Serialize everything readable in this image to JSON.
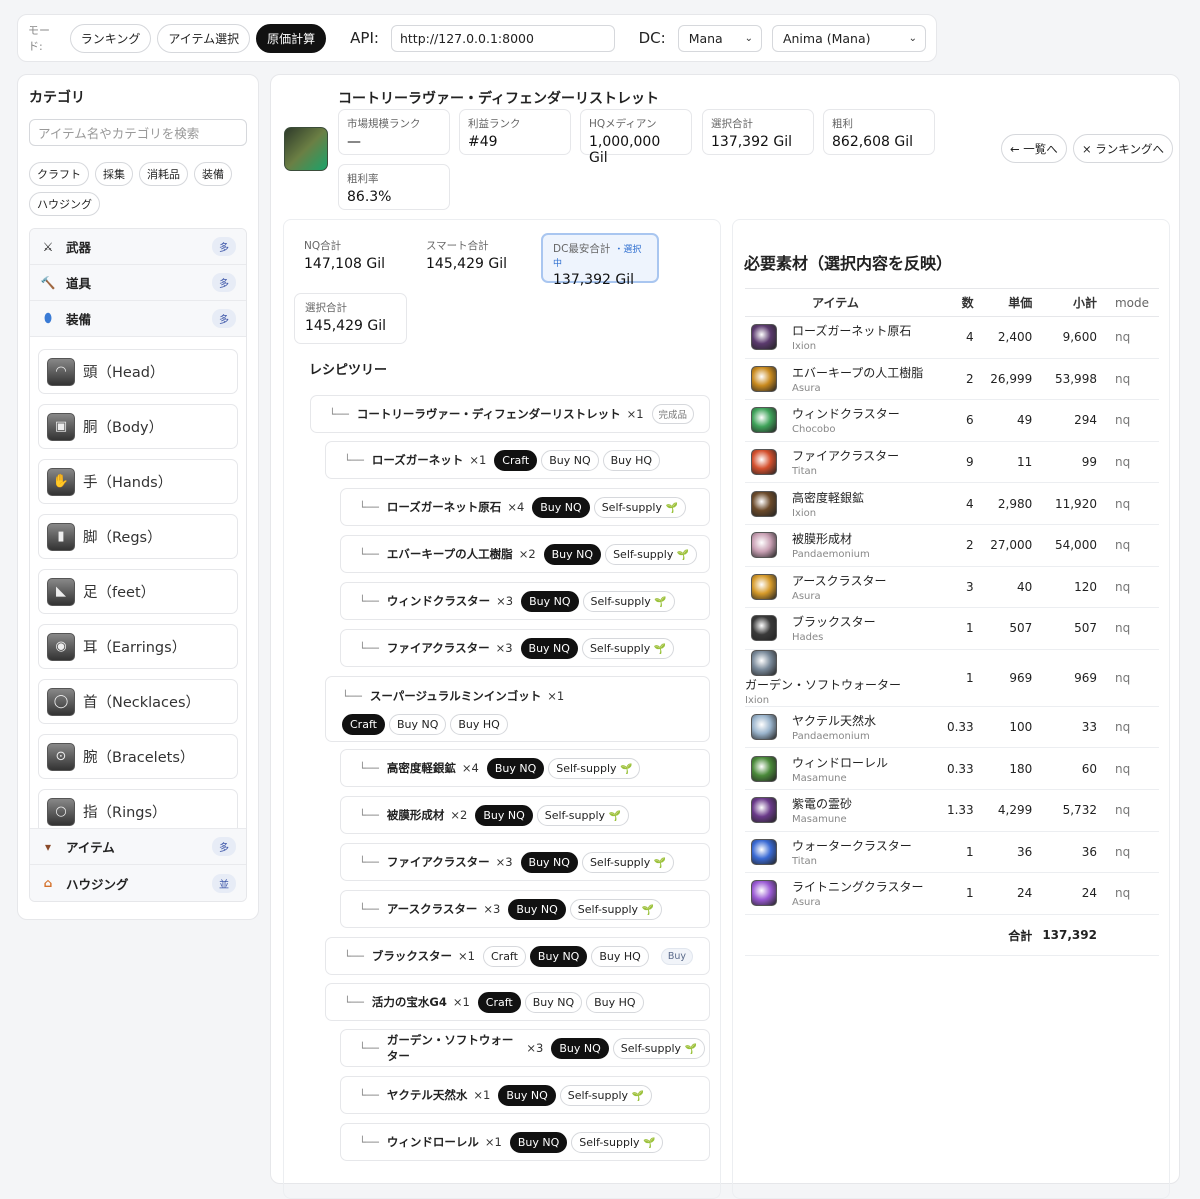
{
  "topbar": {
    "mode_label": "モード:",
    "modes": [
      "ランキング",
      "アイテム選択",
      "原価計算"
    ],
    "api_label": "API:",
    "api_value": "http://127.0.0.1:8000",
    "dc_label": "DC:",
    "dc_value": "Mana",
    "world_value": "Anima (Mana)"
  },
  "sidebar": {
    "title": "カテゴリ",
    "search_placeholder": "アイテム名やカテゴリを検索",
    "chips": [
      "クラフト",
      "採集",
      "消耗品",
      "装備",
      "ハウジング"
    ],
    "categories": [
      {
        "label": "武器",
        "badge": "多",
        "icon": "swords-icon"
      },
      {
        "label": "道具",
        "badge": "多",
        "icon": "hammer-icon"
      },
      {
        "label": "装備",
        "badge": "多",
        "icon": "shield-icon"
      }
    ],
    "equip_sub": [
      {
        "label": "頭（Head）",
        "icon": "helmet-icon"
      },
      {
        "label": "胴（Body）",
        "icon": "armor-icon"
      },
      {
        "label": "手（Hands）",
        "icon": "gloves-icon"
      },
      {
        "label": "脚（Regs）",
        "icon": "legs-icon"
      },
      {
        "label": "足（feet）",
        "icon": "boots-icon"
      },
      {
        "label": "耳（Earrings）",
        "icon": "earring-icon"
      },
      {
        "label": "首（Necklaces）",
        "icon": "necklace-icon"
      },
      {
        "label": "腕（Bracelets）",
        "icon": "bracelet-icon"
      },
      {
        "label": "指（Rings）",
        "icon": "ring-icon"
      }
    ],
    "categories_bottom": [
      {
        "label": "アイテム",
        "badge": "多",
        "icon": "pot-icon"
      },
      {
        "label": "ハウジング",
        "badge": "並",
        "icon": "house-icon"
      }
    ]
  },
  "item": {
    "title": "コートリーラヴァー・ディフェンダーリストレット",
    "stats": [
      {
        "label": "市場規模ランク",
        "value": "—"
      },
      {
        "label": "利益ランク",
        "value": "#49"
      },
      {
        "label": "HQメディアン",
        "value": "1,000,000 Gil"
      },
      {
        "label": "選択合計",
        "value": "137,392 Gil"
      },
      {
        "label": "粗利",
        "value": "862,608 Gil"
      },
      {
        "label": "粗利率",
        "value": "86.3%"
      }
    ],
    "back_label": "← 一覧へ",
    "ranking_label": "× ランキングへ"
  },
  "totals": {
    "nq_label": "NQ合計",
    "nq_value": "147,108 Gil",
    "smart_label": "スマート合計",
    "smart_value": "145,429 Gil",
    "dc_label": "DC最安合計",
    "dc_value": "137,392 Gil",
    "selected_tag": "・選択中",
    "sel_label": "選択合計",
    "sel_value": "145,429 Gil"
  },
  "recipe": {
    "title": "レシピツリー",
    "branch": "└──",
    "done_label": "完成品",
    "craft": "Craft",
    "buy_nq": "Buy NQ",
    "buy_hq": "Buy HQ",
    "self": "Self-supply",
    "buy": "Buy",
    "sprout": "🌱",
    "root": {
      "name": "コートリーラヴァー・ディフェンダーリストレット",
      "qty": "×1"
    },
    "nodes": [
      {
        "name": "ローズガーネット",
        "qty": "×1"
      },
      {
        "name": "ローズガーネット原石",
        "qty": "×4"
      },
      {
        "name": "エバーキープの人工樹脂",
        "qty": "×2"
      },
      {
        "name": "ウィンドクラスター",
        "qty": "×3"
      },
      {
        "name": "ファイアクラスター",
        "qty": "×3"
      },
      {
        "name": "スーパージュラルミンインゴット",
        "qty": "×1"
      },
      {
        "name": "高密度軽銀鉱",
        "qty": "×4"
      },
      {
        "name": "被膜形成材",
        "qty": "×2"
      },
      {
        "name": "ファイアクラスター",
        "qty": "×3"
      },
      {
        "name": "アースクラスター",
        "qty": "×3"
      },
      {
        "name": "ブラックスター",
        "qty": "×1"
      },
      {
        "name": "活力の宝水G4",
        "qty": "×1"
      },
      {
        "name": "ガーデン・ソフトウォーター",
        "qty": "×3"
      },
      {
        "name": "ヤクテル天然水",
        "qty": "×1"
      },
      {
        "name": "ウィンドローレル",
        "qty": "×1"
      }
    ]
  },
  "materials": {
    "title": "必要素材（選択内容を反映）",
    "headers": [
      "アイテム",
      "数",
      "単価",
      "小計",
      "mode"
    ],
    "rows": [
      {
        "name": "ローズガーネット原石",
        "world": "Ixion",
        "qty": "4",
        "price": "2,400",
        "sub": "9,600",
        "mode": "nq",
        "color": "#5b3a6e"
      },
      {
        "name": "エバーキープの人工樹脂",
        "world": "Asura",
        "qty": "2",
        "price": "26,999",
        "sub": "53,998",
        "mode": "nq",
        "color": "#c98a1e"
      },
      {
        "name": "ウィンドクラスター",
        "world": "Chocobo",
        "qty": "6",
        "price": "49",
        "sub": "294",
        "mode": "nq",
        "color": "#3fa35a"
      },
      {
        "name": "ファイアクラスター",
        "world": "Titan",
        "qty": "9",
        "price": "11",
        "sub": "99",
        "mode": "nq",
        "color": "#d4502e"
      },
      {
        "name": "高密度軽銀鉱",
        "world": "Ixion",
        "qty": "4",
        "price": "2,980",
        "sub": "11,920",
        "mode": "nq",
        "color": "#6b4a2a"
      },
      {
        "name": "被膜形成材",
        "world": "Pandaemonium",
        "qty": "2",
        "price": "27,000",
        "sub": "54,000",
        "mode": "nq",
        "color": "#c9a0b4"
      },
      {
        "name": "アースクラスター",
        "world": "Asura",
        "qty": "3",
        "price": "40",
        "sub": "120",
        "mode": "nq",
        "color": "#d69a2a"
      },
      {
        "name": "ブラックスター",
        "world": "Hades",
        "qty": "1",
        "price": "507",
        "sub": "507",
        "mode": "nq",
        "color": "#3a3a3a"
      },
      {
        "name": "ガーデン・ソフトウォーター",
        "world": "Ixion",
        "qty": "1",
        "price": "969",
        "sub": "969",
        "mode": "nq",
        "color": "#7a8a9a"
      },
      {
        "name": "ヤクテル天然水",
        "world": "Pandaemonium",
        "qty": "0.33",
        "price": "100",
        "sub": "33",
        "mode": "nq",
        "color": "#9ab4cc"
      },
      {
        "name": "ウィンドローレル",
        "world": "Masamune",
        "qty": "0.33",
        "price": "180",
        "sub": "60",
        "mode": "nq",
        "color": "#4a8a3a"
      },
      {
        "name": "紫電の霊砂",
        "world": "Masamune",
        "qty": "1.33",
        "price": "4,299",
        "sub": "5,732",
        "mode": "nq",
        "color": "#6a3a8a"
      },
      {
        "name": "ウォータークラスター",
        "world": "Titan",
        "qty": "1",
        "price": "36",
        "sub": "36",
        "mode": "nq",
        "color": "#3a6ad4"
      },
      {
        "name": "ライトニングクラスター",
        "world": "Asura",
        "qty": "1",
        "price": "24",
        "sub": "24",
        "mode": "nq",
        "color": "#9a5ad4"
      }
    ],
    "sum_label": "合計",
    "sum_value": "137,392"
  }
}
